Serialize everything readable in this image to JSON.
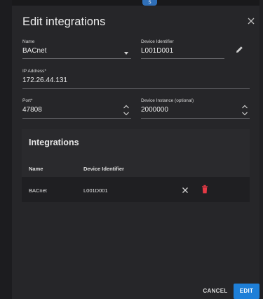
{
  "top_chip": {
    "text": "S"
  },
  "dialog": {
    "title": "Edit integrations",
    "form": {
      "name": {
        "label": "Name",
        "value": "BACnet"
      },
      "device_identifier": {
        "label": "Device Identifier",
        "value": "L001D001"
      },
      "ip_address": {
        "label": "IP Address*",
        "value": "172.26.44.131"
      },
      "port": {
        "label": "Port*",
        "value": "47808"
      },
      "device_instance": {
        "label": "Device Instance (optional)",
        "value": "2000000"
      }
    },
    "integrations": {
      "title": "Integrations",
      "headers": [
        "Name",
        "Device Identifier"
      ],
      "rows": [
        {
          "name": "BACnet",
          "device_identifier": "L001D001"
        }
      ]
    },
    "actions": {
      "cancel": "CANCEL",
      "edit": "EDIT"
    }
  },
  "colors": {
    "dialog_bg": "#262629",
    "accent": "#1e7fd8",
    "delete_icon": "#e53945"
  },
  "icons": [
    "close-icon",
    "pencil-icon",
    "chevron-down-icon",
    "stepper-icon",
    "trash-icon"
  ]
}
